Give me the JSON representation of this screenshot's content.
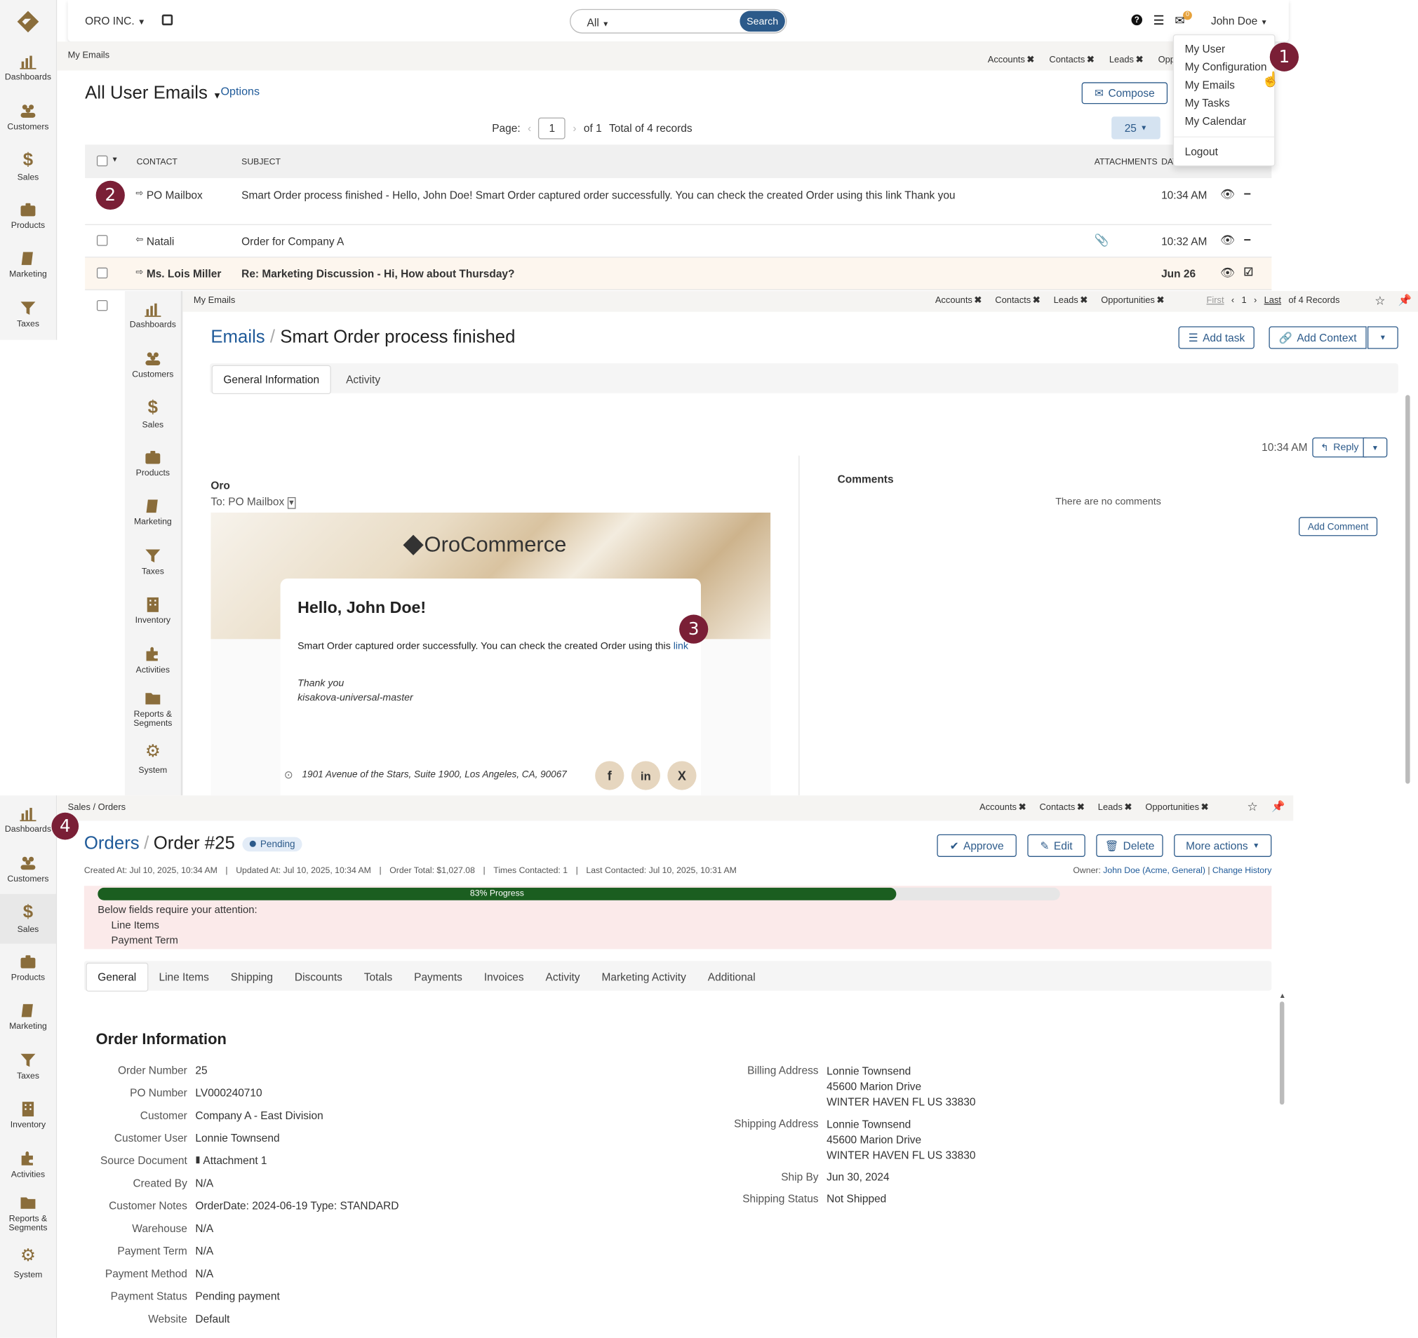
{
  "nav": {
    "items": [
      "Dashboards",
      "Customers",
      "Sales",
      "Products",
      "Marketing",
      "Taxes",
      "Inventory",
      "Activities",
      "Reports & Segments",
      "System"
    ]
  },
  "topbar": {
    "org": "ORO INC.",
    "search_scope": "All",
    "search_button": "Search",
    "user_name": "John Doe",
    "mail_count": "0"
  },
  "user_menu": [
    "My User",
    "My Configuration",
    "My Emails",
    "My Tasks",
    "My Calendar",
    "Logout"
  ],
  "pins": [
    "Accounts",
    "Contacts",
    "Leads",
    "Opportunities"
  ],
  "pins_truncated": "Oppo",
  "callouts": [
    "1",
    "2",
    "3",
    "4"
  ],
  "emails": {
    "breadcrumb": "My Emails",
    "title": "All User Emails",
    "options": "Options",
    "compose": "Compose",
    "page_label": "Page:",
    "page_value": "1",
    "of_pages": "of 1",
    "total": "Total of 4 records",
    "page_size": "25",
    "cols": {
      "contact": "CONTACT",
      "subject": "SUBJECT",
      "attachments": "ATTACHMENTS",
      "date": "DAT"
    },
    "rows": [
      {
        "contact": "PO Mailbox",
        "subject": "Smart Order process finished - Hello, John Doe! Smart Order captured order successfully. You can check the created Order using this link Thank you",
        "time": "10:34 AM"
      },
      {
        "contact": "Natali",
        "subject": "Order for Company A",
        "time": "10:32 AM"
      },
      {
        "contact": "Ms. Lois Miller",
        "subject": "Re: Marketing Discussion - Hi, How about Thursday?",
        "time": "Jun 26"
      }
    ]
  },
  "email_view": {
    "breadcrumb": "My Emails",
    "nav_first": "First",
    "nav_page": "1",
    "nav_last": "Last",
    "nav_total": "of 4 Records",
    "title_link": "Emails",
    "sep": "/",
    "title": "Smart Order process finished",
    "add_task": "Add task",
    "add_context": "Add Context",
    "tabs": [
      "General Information",
      "Activity"
    ],
    "time": "10:34 AM",
    "reply": "Reply",
    "from": "Oro",
    "to": "To: PO Mailbox",
    "brand": "OroCommerce",
    "greeting": "Hello, John Doe!",
    "body": "Smart Order captured order successfully. You can check the created Order using this",
    "body_link": "link",
    "thanks": "Thank you",
    "signature": "kisakova-universal-master",
    "address": "1901 Avenue of the Stars, Suite 1900, Los Angeles, CA, 90067",
    "comments_title": "Comments",
    "no_comments": "There are no comments",
    "add_comment": "Add Comment"
  },
  "order": {
    "breadcrumb": "Sales / Orders",
    "title_link": "Orders",
    "sep": "/",
    "title": "Order #25",
    "status": "Pending",
    "buttons": [
      "Approve",
      "Edit",
      "Delete",
      "More actions"
    ],
    "meta": [
      "Created At: Jul 10, 2025, 10:34 AM",
      "Updated At: Jul 10, 2025, 10:34 AM",
      "Order Total: $1,027.08",
      "Times Contacted: 1",
      "Last Contacted: Jul 10, 2025, 10:31 AM"
    ],
    "owner_label": "Owner:",
    "owner": "John Doe (Acme, General)",
    "change_history": "Change History",
    "progress_percent": 83,
    "progress_label": "83% Progress",
    "attention": "Below fields require your attention:",
    "attention_items": [
      "Line Items",
      "Payment Term"
    ],
    "tabs": [
      "General",
      "Line Items",
      "Shipping",
      "Discounts",
      "Totals",
      "Payments",
      "Invoices",
      "Activity",
      "Marketing Activity",
      "Additional"
    ],
    "section_title": "Order Information",
    "fields_left": [
      {
        "k": "Order Number",
        "v": "25"
      },
      {
        "k": "PO Number",
        "v": "LV000240710"
      },
      {
        "k": "Customer",
        "v": "Company A - East Division",
        "link": true
      },
      {
        "k": "Customer User",
        "v": "Lonnie Townsend",
        "link": true
      },
      {
        "k": "Source Document",
        "v": "Attachment 1",
        "link": true
      },
      {
        "k": "Created By",
        "v": "N/A"
      },
      {
        "k": "Customer Notes",
        "v": "OrderDate: 2024-06-19 Type: STANDARD"
      },
      {
        "k": "Warehouse",
        "v": "N/A"
      },
      {
        "k": "Payment Term",
        "v": "N/A"
      },
      {
        "k": "Payment Method",
        "v": "N/A"
      },
      {
        "k": "Payment Status",
        "v": "Pending payment"
      },
      {
        "k": "Website",
        "v": "Default"
      }
    ],
    "billing_label": "Billing Address",
    "billing": [
      "Lonnie Townsend",
      "45600 Marion Drive",
      "WINTER HAVEN FL US 33830"
    ],
    "shipping_label": "Shipping Address",
    "shipping": [
      "Lonnie Townsend",
      "45600 Marion Drive",
      "WINTER HAVEN FL US 33830"
    ],
    "ship_by_label": "Ship By",
    "ship_by": "Jun 30, 2024",
    "ship_status_label": "Shipping Status",
    "ship_status": "Not Shipped"
  },
  "colors": {
    "accent": "#1f5a99",
    "brand": "#8a6d3b",
    "callout": "#7a1f36",
    "progress": "#1b5e20",
    "alert_bg": "#fbeaea"
  }
}
